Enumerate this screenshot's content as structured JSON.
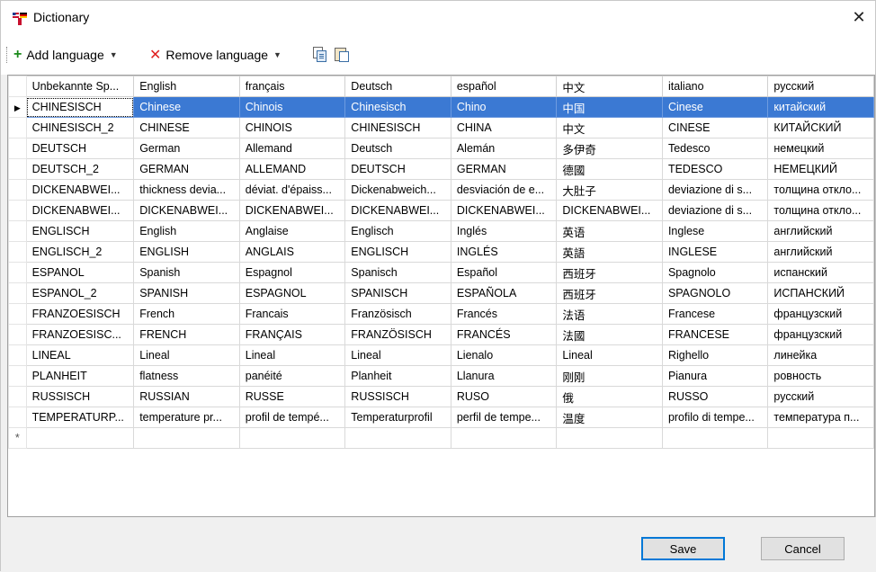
{
  "window": {
    "title": "Dictionary",
    "close_glyph": "✕"
  },
  "toolbar": {
    "add_language": "Add language",
    "remove_language": "Remove language",
    "icons": [
      "plus-icon",
      "remove-x-icon",
      "caret-down-icon",
      "copy-icon",
      "paste-icon"
    ],
    "colors": {
      "add": "#1a8a1a",
      "remove": "#e02020",
      "selection": "#3b79d3"
    }
  },
  "grid": {
    "columns": [
      "Unbekannte Sp...",
      "English",
      "français",
      "Deutsch",
      "español",
      "中文",
      "italiano",
      "русский"
    ],
    "selected_row": 0,
    "current_row_marker": "▶",
    "new_row_marker": "*",
    "rows": [
      [
        "CHINESISCH",
        "Chinese",
        "Chinois",
        "Chinesisch",
        "Chino",
        "中国",
        "Cinese",
        "китайский"
      ],
      [
        "CHINESISCH_2",
        "CHINESE",
        "CHINOIS",
        "CHINESISCH",
        "CHINA",
        "中文",
        "CINESE",
        "КИТАЙСКИЙ"
      ],
      [
        "DEUTSCH",
        "German",
        "Allemand",
        "Deutsch",
        "Alemán",
        "多伊奇",
        "Tedesco",
        "немецкий"
      ],
      [
        "DEUTSCH_2",
        "GERMAN",
        "ALLEMAND",
        "DEUTSCH",
        "GERMAN",
        "德國",
        "TEDESCO",
        "НЕМЕЦКИЙ"
      ],
      [
        "DICKENABWEI...",
        "thickness devia...",
        "déviat. d'épaiss...",
        "Dickenabweich...",
        "desviación de e...",
        "大肚子",
        "deviazione di s...",
        "толщина откло..."
      ],
      [
        "DICKENABWEI...",
        "DICKENABWEI...",
        "DICKENABWEI...",
        "DICKENABWEI...",
        "DICKENABWEI...",
        "DICKENABWEI...",
        "deviazione di s...",
        "толщина откло..."
      ],
      [
        "ENGLISCH",
        "English",
        "Anglaise",
        "Englisch",
        "Inglés",
        "英语",
        "Inglese",
        "английский"
      ],
      [
        "ENGLISCH_2",
        "ENGLISH",
        "ANGLAIS",
        "ENGLISCH",
        "INGLÉS",
        "英語",
        "INGLESE",
        "английский"
      ],
      [
        "ESPANOL",
        "Spanish",
        "Espagnol",
        "Spanisch",
        "Español",
        "西班牙",
        "Spagnolo",
        "испанский"
      ],
      [
        "ESPANOL_2",
        "SPANISH",
        "ESPAGNOL",
        "SPANISCH",
        "ESPAÑOLA",
        "西班牙",
        "SPAGNOLO",
        "ИСПАНСКИЙ"
      ],
      [
        "FRANZOESISCH",
        "French",
        "Francais",
        "Französisch",
        "Francés",
        "法语",
        "Francese",
        "французский"
      ],
      [
        "FRANZOESISC...",
        "FRENCH",
        "FRANÇAIS",
        "FRANZÖSISCH",
        "FRANCÉS",
        "法國",
        "FRANCESE",
        "французский"
      ],
      [
        "LINEAL",
        "Lineal",
        "Lineal",
        "Lineal",
        "Lienalo",
        "Lineal",
        "Righello",
        "линейка"
      ],
      [
        "PLANHEIT",
        "flatness",
        "panéité",
        "Planheit",
        "Llanura",
        "刚刚",
        "Pianura",
        "ровность"
      ],
      [
        "RUSSISCH",
        "RUSSIAN",
        "RUSSE",
        "RUSSISCH",
        "RUSO",
        "俄",
        "RUSSO",
        "русский"
      ],
      [
        "TEMPERATURP...",
        "temperature pr...",
        "profil de tempé...",
        "Temperaturprofil",
        "perfil de tempe...",
        "温度",
        "profilo di tempe...",
        "температура п..."
      ]
    ]
  },
  "buttons": {
    "save": "Save",
    "cancel": "Cancel"
  }
}
